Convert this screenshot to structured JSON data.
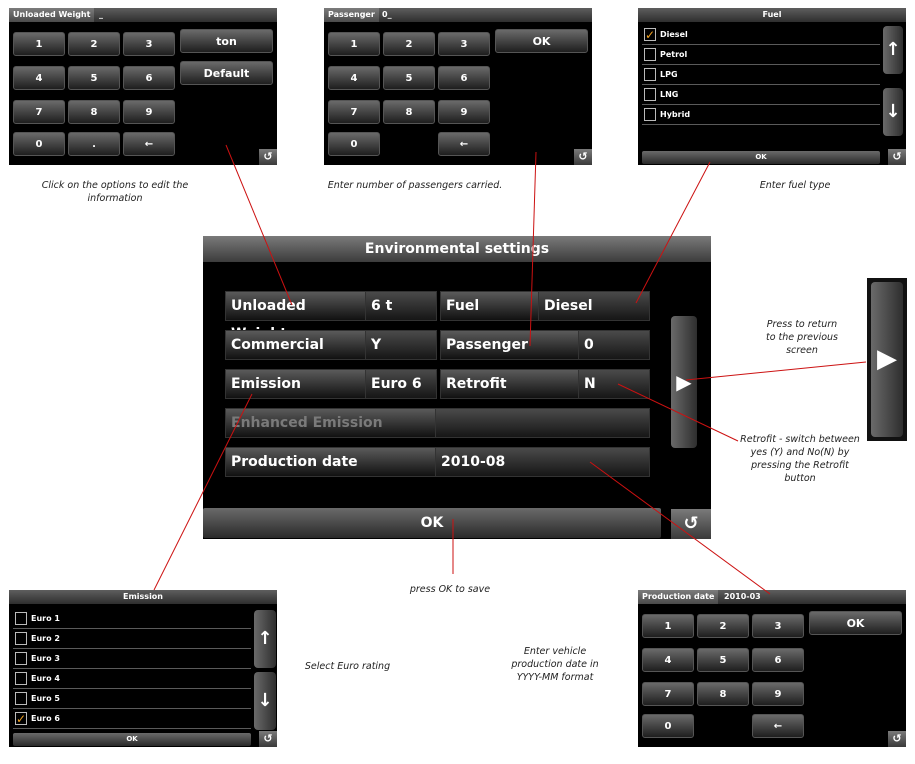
{
  "keypad_weight": {
    "label": "Unloaded Weight",
    "value": "_",
    "keys": [
      "1",
      "2",
      "3",
      "4",
      "5",
      "6",
      "7",
      "8",
      "9",
      "0",
      ".",
      "←"
    ],
    "unit_button": "ton",
    "default_button": "Default",
    "back": "↺"
  },
  "keypad_passenger": {
    "label": "Passenger",
    "value": "0_",
    "keys": [
      "1",
      "2",
      "3",
      "4",
      "5",
      "6",
      "7",
      "8",
      "9",
      "0",
      "←"
    ],
    "ok_button": "OK",
    "back": "↺"
  },
  "fuel_list": {
    "title": "Fuel",
    "items": [
      {
        "label": "Diesel",
        "checked": true
      },
      {
        "label": "Petrol",
        "checked": false
      },
      {
        "label": "LPG",
        "checked": false
      },
      {
        "label": "LNG",
        "checked": false
      },
      {
        "label": "Hybrid",
        "checked": false
      }
    ],
    "ok_button": "OK",
    "up": "↑",
    "down": "↓",
    "back": "↺"
  },
  "main": {
    "title": "Environmental settings",
    "fields": [
      {
        "label": "Unloaded Weight",
        "value": "6 t"
      },
      {
        "label": "Fuel",
        "value": "Diesel"
      },
      {
        "label": "Commercial",
        "value": "Y"
      },
      {
        "label": "Passenger",
        "value": "0"
      },
      {
        "label": "Emission",
        "value": "Euro 6"
      },
      {
        "label": "Retrofit",
        "value": "N"
      },
      {
        "label": "Enhanced Emission",
        "value": ""
      },
      {
        "label": "Production date",
        "value": "2010-08"
      }
    ],
    "ok_button": "OK",
    "next": "▶",
    "back": "↺"
  },
  "side_next": "▶",
  "emission_list": {
    "title": "Emission",
    "items": [
      {
        "label": "Euro 1",
        "checked": false
      },
      {
        "label": "Euro 2",
        "checked": false
      },
      {
        "label": "Euro 3",
        "checked": false
      },
      {
        "label": "Euro 4",
        "checked": false
      },
      {
        "label": "Euro 5",
        "checked": false
      },
      {
        "label": "Euro 6",
        "checked": true
      }
    ],
    "ok_button": "OK",
    "up": "↑",
    "down": "↓",
    "back": "↺"
  },
  "keypad_date": {
    "label": "Production date",
    "value": "2010-03",
    "keys": [
      "1",
      "2",
      "3",
      "4",
      "5",
      "6",
      "7",
      "8",
      "9",
      "0",
      "←"
    ],
    "ok_button": "OK",
    "back": "↺"
  },
  "captions": {
    "weight": "Click on the options to edit the information",
    "passenger": "Enter number of passengers carried.",
    "fuel": "Enter fuel type",
    "return": "Press to return to the previous screen",
    "retrofit": "Retrofit - switch between yes (Y) and No(N) by pressing the Retrofit button",
    "ok_save": "press OK to save",
    "euro": "Select Euro rating",
    "date": "Enter vehicle production date in YYYY-MM format"
  },
  "colors": {
    "annotation_line": "#cc1111",
    "checkmark": "#f0a020"
  }
}
